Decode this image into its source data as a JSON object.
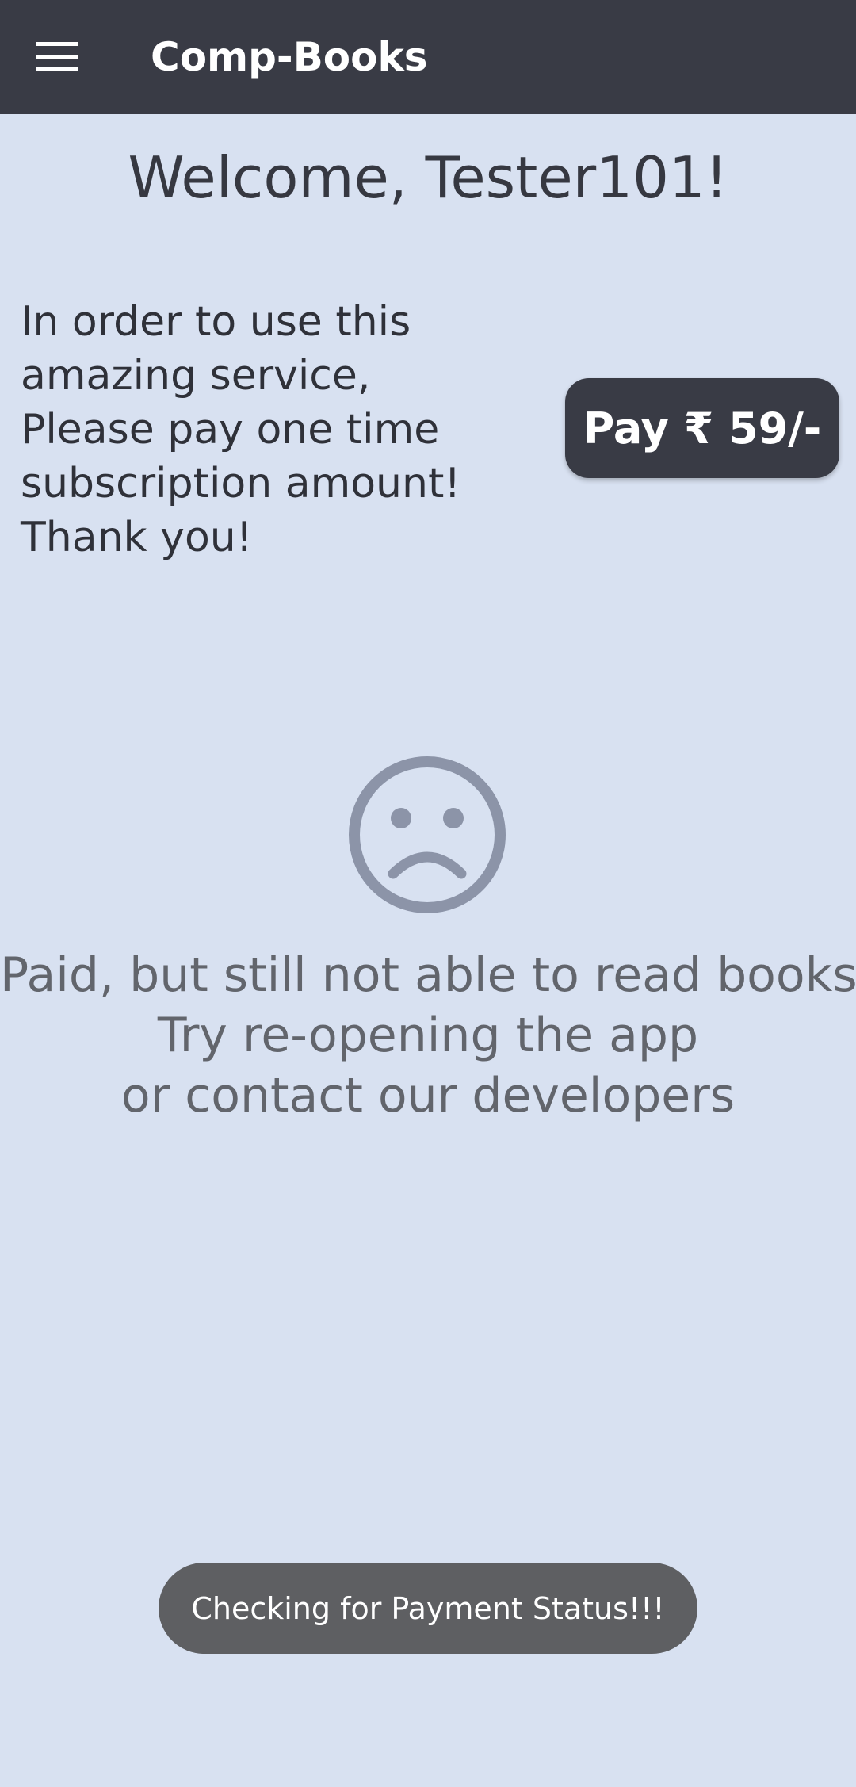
{
  "app_bar": {
    "title": "Comp-Books",
    "menu_icon": "hamburger-menu-icon",
    "background": "#393b45"
  },
  "main": {
    "welcome": "Welcome, Tester101!",
    "info_lines": [
      "In order to use this",
      "amazing service,",
      "Please pay one time",
      "subscription amount!",
      "Thank you!"
    ],
    "pay_button_label": "Pay ₹ 59/-",
    "sad_icon": "sad-face-icon",
    "help_lines": [
      "Paid, but still not able to read books ?",
      "Try re-opening the app",
      "or contact our developers"
    ]
  },
  "toast": {
    "message": "Checking for Payment Status!!!"
  },
  "colors": {
    "background": "#d8e1f1",
    "accent": "#393b45",
    "icon_gray": "#8c94a8",
    "toast": "#5e5f62"
  }
}
